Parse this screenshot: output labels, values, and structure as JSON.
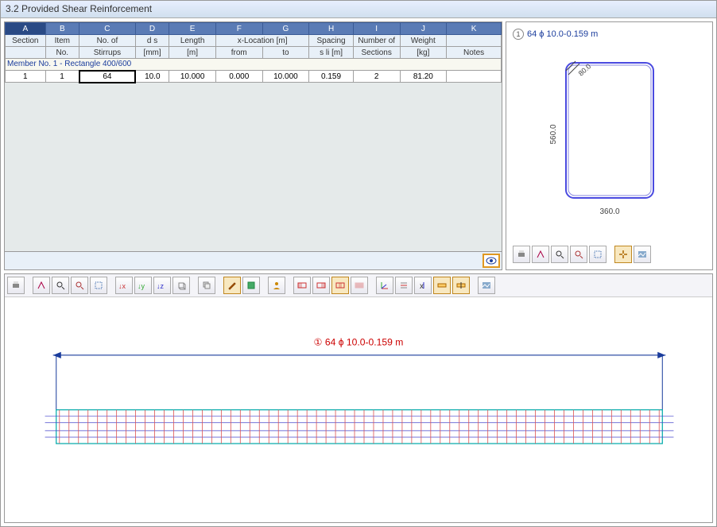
{
  "window": {
    "title": "3.2  Provided Shear Reinforcement"
  },
  "table": {
    "col_letters": [
      "A",
      "B",
      "C",
      "D",
      "E",
      "F",
      "G",
      "H",
      "I",
      "J",
      "K"
    ],
    "headers_row1": [
      "Section",
      "Item",
      "No. of",
      "d s",
      "Length",
      "x-Location [m]",
      "",
      "Spacing",
      "Number of",
      "Weight",
      ""
    ],
    "headers_row2": [
      "",
      "No.",
      "Stirrups",
      "[mm]",
      "[m]",
      "from",
      "to",
      "s li [m]",
      "Sections",
      "[kg]",
      "Notes"
    ],
    "member_row": "Member No. 1  -  Rectangle 400/600",
    "data_row": [
      "1",
      "1",
      "64",
      "10.0",
      "10.000",
      "0.000",
      "10.000",
      "0.159",
      "2",
      "81.20",
      ""
    ]
  },
  "section": {
    "label": "64 ϕ 10.0-0.159 m",
    "dim_h": "360.0",
    "dim_v": "560.0",
    "dim_diag": "80.0"
  },
  "beam": {
    "label": "64 ϕ 10.0-0.159 m"
  },
  "section_tools": [
    "print",
    "explore",
    "zoom",
    "zoom-out",
    "select",
    "expand",
    "image"
  ],
  "lower_tools": [
    "print",
    "explore",
    "zoom",
    "zoom-out",
    "grid",
    "x-axis",
    "y-axis",
    "z-axis",
    "3d",
    "copy",
    "pen",
    "box",
    "user",
    "panel1",
    "panel2",
    "panel3",
    "panel4",
    "axes",
    "lines",
    "x-opt",
    "h1",
    "h2",
    "image"
  ]
}
